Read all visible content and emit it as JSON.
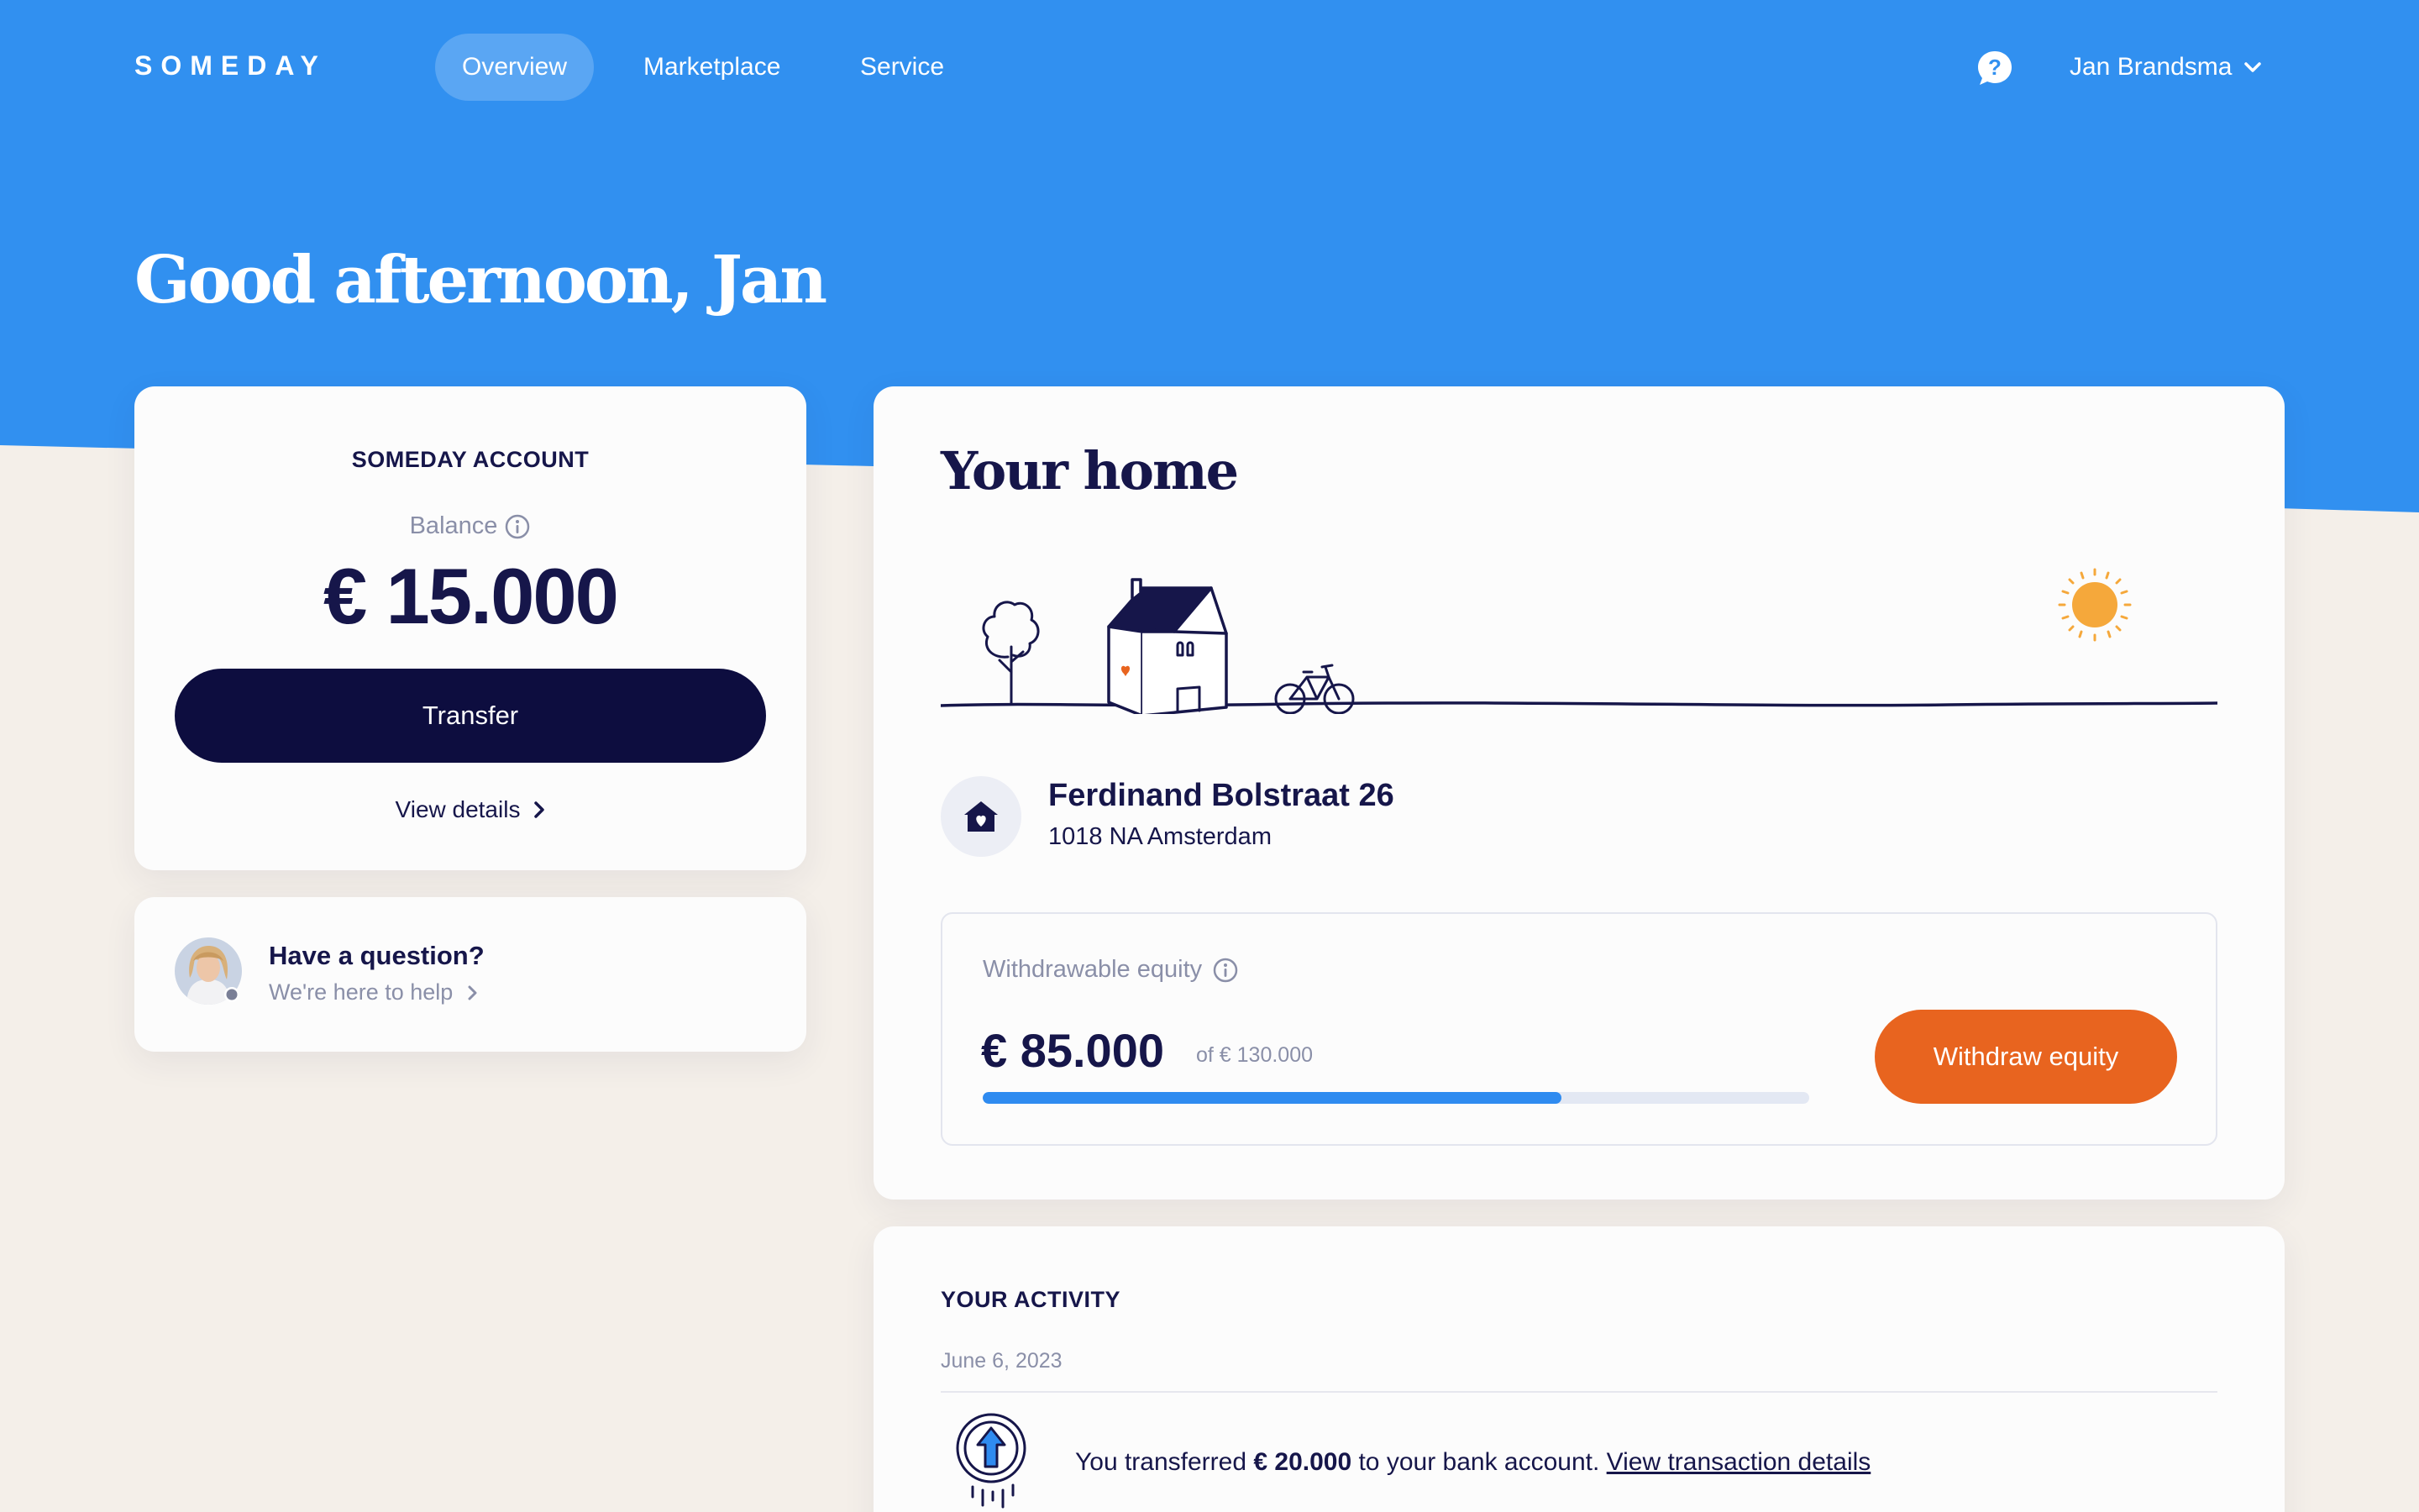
{
  "colors": {
    "header_blue": "#3190F0",
    "page_bg": "#F4EFE9",
    "navy": "#16164A",
    "button_dark": "#0D0D3F",
    "accent_orange": "#E8641F",
    "progress_blue": "#2F8BF0"
  },
  "nav": {
    "logo": "SOMEDAY",
    "items": [
      {
        "label": "Overview",
        "active": true
      },
      {
        "label": "Marketplace",
        "active": false
      },
      {
        "label": "Service",
        "active": false
      }
    ],
    "help_icon": "question-bubble-icon",
    "user_name": "Jan Brandsma"
  },
  "greeting": "Good afternoon, Jan",
  "account": {
    "title": "SOMEDAY ACCOUNT",
    "balance_label": "Balance",
    "balance_value": "€ 15.000",
    "transfer_label": "Transfer",
    "view_details_label": "View details"
  },
  "support": {
    "title": "Have a question?",
    "subtitle": "We're here to help"
  },
  "home": {
    "title": "Your home",
    "street": "Ferdinand Bolstraat 26",
    "city": "1018 NA Amsterdam",
    "equity_label": "Withdrawable equity",
    "equity_value": "€ 85.000",
    "equity_of": "of € 130.000",
    "equity_fraction": 0.7,
    "withdraw_label": "Withdraw equity"
  },
  "activity": {
    "title": "YOUR ACTIVITY",
    "date": "June 6, 2023",
    "text_before": "You transferred ",
    "amount": "€ 20.000",
    "text_after": " to your bank account. ",
    "link_label": "View transaction details"
  }
}
